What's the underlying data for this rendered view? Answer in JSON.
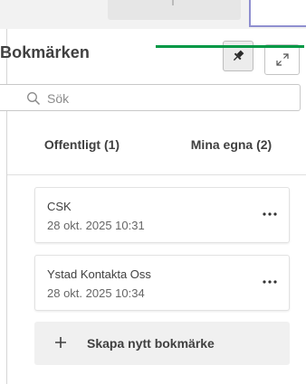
{
  "panel": {
    "title": "Bokmärken"
  },
  "search": {
    "placeholder": "Sök",
    "value": ""
  },
  "tabs": [
    {
      "label": "Offentligt (1)",
      "selected": false
    },
    {
      "label": "Mina egna (2)",
      "selected": true
    }
  ],
  "bookmarks": [
    {
      "name": "CSK",
      "date": "28 okt. 2025 10:31"
    },
    {
      "name": "Ystad Kontakta Oss",
      "date": "28 okt. 2025 10:34"
    }
  ],
  "create_button": {
    "label": "Skapa nytt bokmärke"
  },
  "colors": {
    "accent": "#009845",
    "text": "#404040",
    "muted_text": "#666666",
    "border": "#e2e2e2",
    "active_frame": "#8f8fd0"
  },
  "icons": {
    "pin": "pin-icon",
    "expand": "expand-icon",
    "search": "search-icon",
    "more": "more-options-icon",
    "plus": "plus-icon"
  }
}
